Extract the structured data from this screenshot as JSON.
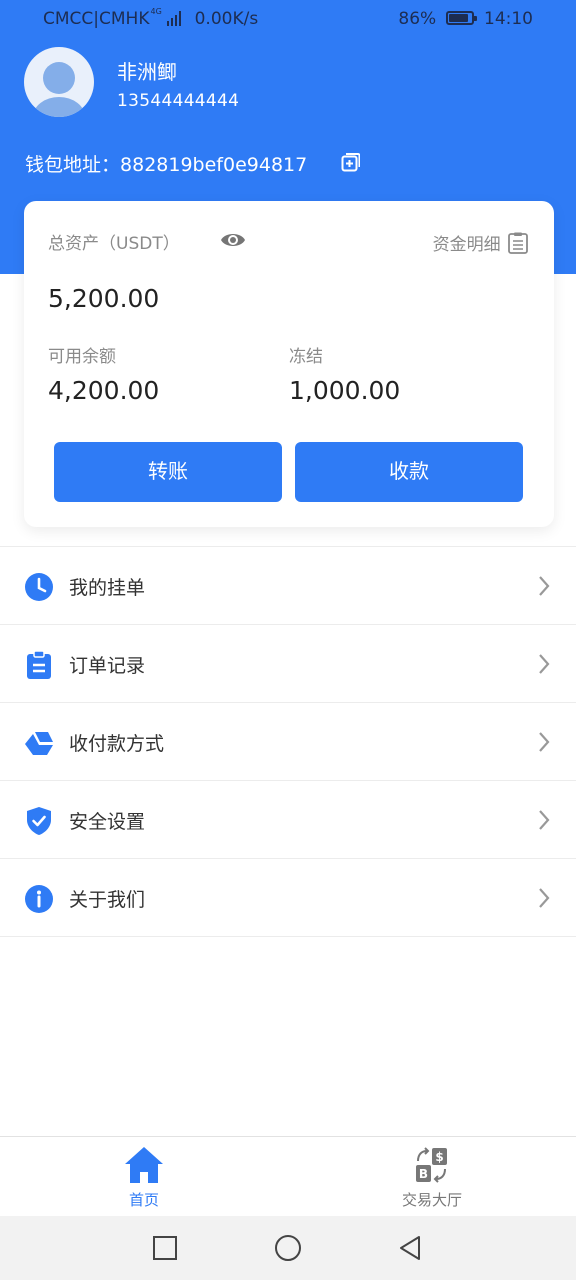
{
  "status_bar": {
    "carrier": "CMCC|CMHK",
    "network_badge": "4G",
    "speed": "0.00K/s",
    "battery_percent": "86%",
    "battery_level": 0.86,
    "time": "14:10"
  },
  "profile": {
    "name": "非洲鲫",
    "phone": "13544444444",
    "wallet_label": "钱包地址：",
    "wallet_address": "882819bef0e94817"
  },
  "assets": {
    "total_label": "总资产（USDT）",
    "total_value": "5,200.00",
    "detail_link": "资金明细",
    "available_label": "可用余额",
    "available_value": "4,200.00",
    "frozen_label": "冻结",
    "frozen_value": "1,000.00",
    "transfer_button": "转账",
    "receive_button": "收款"
  },
  "menu": [
    {
      "label": "我的挂单",
      "icon": "clock-icon"
    },
    {
      "label": "订单记录",
      "icon": "clipboard-icon"
    },
    {
      "label": "收付款方式",
      "icon": "payment-method-icon"
    },
    {
      "label": "安全设置",
      "icon": "shield-check-icon"
    },
    {
      "label": "关于我们",
      "icon": "info-icon"
    }
  ],
  "tabbar": {
    "home": "首页",
    "trading_hall": "交易大厅"
  },
  "colors": {
    "primary": "#2f7bf5",
    "status_text": "#1d2d52",
    "muted_text": "#8a8a8a",
    "tab_inactive": "#777777"
  }
}
